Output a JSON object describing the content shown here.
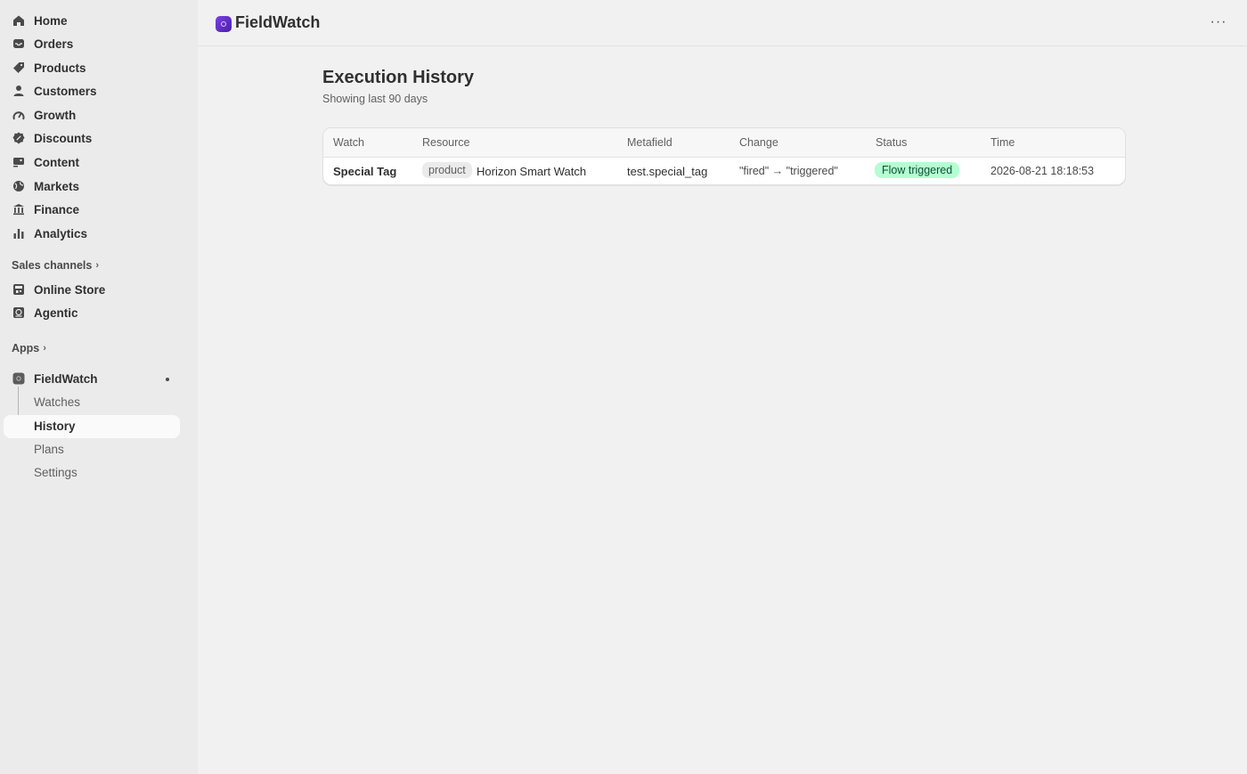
{
  "sidebar": {
    "nav": [
      {
        "label": "Home",
        "icon": "home-icon"
      },
      {
        "label": "Orders",
        "icon": "inbox-icon"
      },
      {
        "label": "Products",
        "icon": "tag-icon"
      },
      {
        "label": "Customers",
        "icon": "person-icon"
      },
      {
        "label": "Growth",
        "icon": "gauge-icon"
      },
      {
        "label": "Discounts",
        "icon": "discount-icon"
      },
      {
        "label": "Content",
        "icon": "image-icon"
      },
      {
        "label": "Markets",
        "icon": "globe-icon"
      },
      {
        "label": "Finance",
        "icon": "bank-icon"
      },
      {
        "label": "Analytics",
        "icon": "bar-chart-icon"
      }
    ],
    "sales_channels_label": "Sales channels",
    "channels": [
      {
        "label": "Online Store",
        "icon": "store-icon"
      },
      {
        "label": "Agentic",
        "icon": "agent-icon"
      }
    ],
    "apps_label": "Apps",
    "app": {
      "label": "FieldWatch",
      "sub_items": [
        "Watches",
        "History",
        "Plans",
        "Settings"
      ],
      "active": "History"
    }
  },
  "header": {
    "app_title": "FieldWatch",
    "more_label": "···"
  },
  "page": {
    "title": "Execution History",
    "subtitle": "Showing last 90 days"
  },
  "table": {
    "columns": [
      "Watch",
      "Resource",
      "Metafield",
      "Change",
      "Status",
      "Time"
    ],
    "rows": [
      {
        "watch": "Special Tag",
        "resource_type": "product",
        "resource_name": "Horizon Smart Watch",
        "metafield": "test.special_tag",
        "change": "\"fired\" → \"triggered\"",
        "status": "Flow triggered",
        "time": "2026-08-21 18:18:53"
      }
    ]
  },
  "colors": {
    "status_bg": "#b4fed2",
    "status_fg": "#0c5132",
    "app_accent": "#6a2fd6"
  }
}
